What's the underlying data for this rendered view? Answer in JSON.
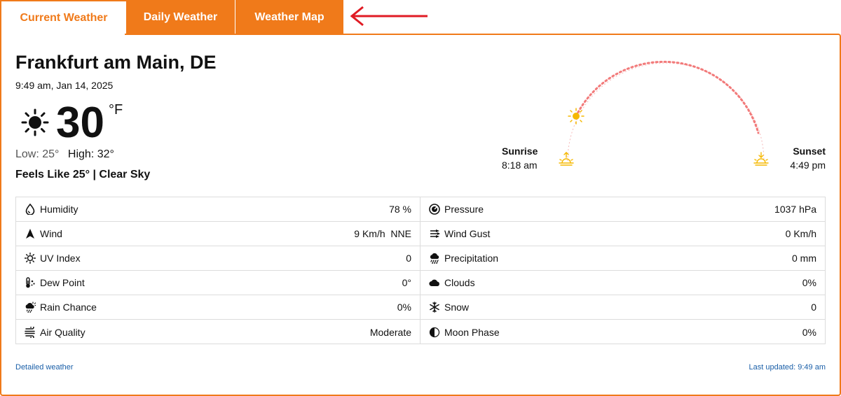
{
  "tabs": [
    {
      "label": "Current Weather",
      "active": true
    },
    {
      "label": "Daily Weather",
      "active": false
    },
    {
      "label": "Weather Map",
      "active": false
    }
  ],
  "colors": {
    "accent": "#f07a1a",
    "arrow": "#e01b24",
    "link": "#1a5fa8",
    "arc": "#f27a7a",
    "sun": "#f5b800"
  },
  "location": {
    "city": "Frankfurt am Main, DE"
  },
  "datetime": "9:49 am, Jan 14, 2025",
  "current": {
    "icon": "sun-icon",
    "temp": "30",
    "unit": "°F",
    "low": "Low: 25°",
    "high": "High: 32°",
    "feels": "Feels Like 25° | Clear Sky"
  },
  "sun": {
    "sunrise_label": "Sunrise",
    "sunrise_time": "8:18 am",
    "sunset_label": "Sunset",
    "sunset_time": "4:49 pm"
  },
  "metrics": [
    {
      "icon": "humidity-icon",
      "name": "Humidity",
      "value": "78 %"
    },
    {
      "icon": "pressure-icon",
      "name": "Pressure",
      "value": "1037 hPa"
    },
    {
      "icon": "wind-arrow-icon",
      "name": "Wind",
      "value": "9 Km/h  NNE"
    },
    {
      "icon": "wind-gust-icon",
      "name": "Wind Gust",
      "value": "0 Km/h"
    },
    {
      "icon": "uv-icon",
      "name": "UV Index",
      "value": "0"
    },
    {
      "icon": "precipitation-icon",
      "name": "Precipitation",
      "value": "0 mm"
    },
    {
      "icon": "dew-point-icon",
      "name": "Dew Point",
      "value": "0°"
    },
    {
      "icon": "clouds-icon",
      "name": "Clouds",
      "value": "0%"
    },
    {
      "icon": "rain-chance-icon",
      "name": "Rain Chance",
      "value": "0%"
    },
    {
      "icon": "snow-icon",
      "name": "Snow",
      "value": "0"
    },
    {
      "icon": "air-quality-icon",
      "name": "Air Quality",
      "value": "Moderate"
    },
    {
      "icon": "moon-phase-icon",
      "name": "Moon Phase",
      "value": "0%"
    }
  ],
  "footer": {
    "detailed_link": "Detailed weather",
    "last_updated": "Last updated: 9:49 am"
  }
}
